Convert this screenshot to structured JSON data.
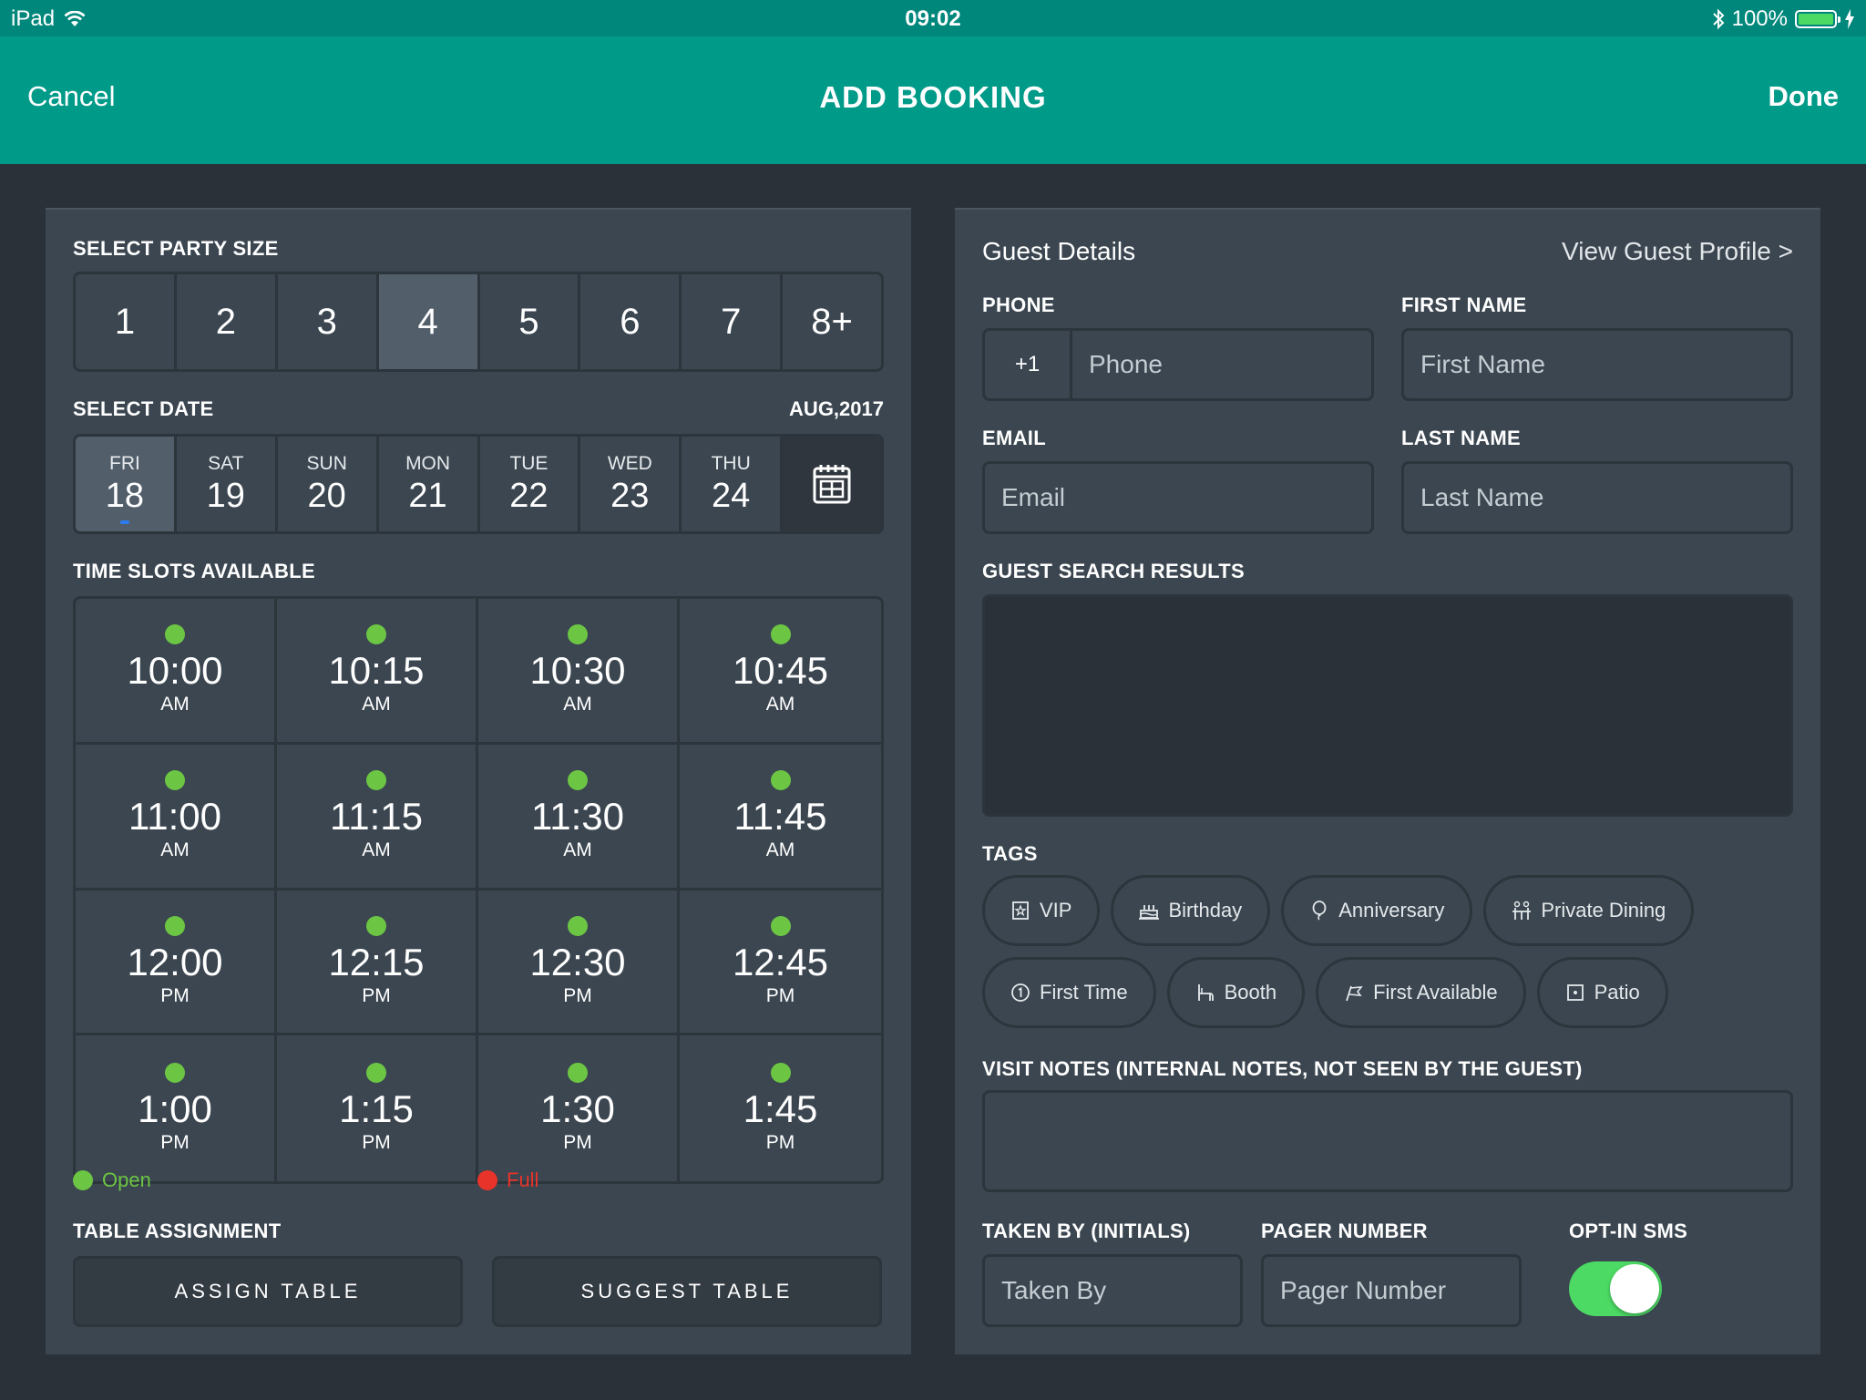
{
  "status_bar": {
    "device": "iPad",
    "time": "09:02",
    "battery": "100%"
  },
  "nav": {
    "cancel": "Cancel",
    "title": "ADD BOOKING",
    "done": "Done"
  },
  "left": {
    "party_label": "SELECT PARTY SIZE",
    "party_sizes": [
      "1",
      "2",
      "3",
      "4",
      "5",
      "6",
      "7",
      "8+"
    ],
    "party_selected": "4",
    "date_label": "SELECT DATE",
    "date_month": "AUG,2017",
    "dates": [
      {
        "dow": "FRI",
        "num": "18"
      },
      {
        "dow": "SAT",
        "num": "19"
      },
      {
        "dow": "SUN",
        "num": "20"
      },
      {
        "dow": "MON",
        "num": "21"
      },
      {
        "dow": "TUE",
        "num": "22"
      },
      {
        "dow": "WED",
        "num": "23"
      },
      {
        "dow": "THU",
        "num": "24"
      }
    ],
    "slots_label": "TIME SLOTS AVAILABLE",
    "slots": [
      {
        "time": "10:00",
        "ampm": "AM"
      },
      {
        "time": "10:15",
        "ampm": "AM"
      },
      {
        "time": "10:30",
        "ampm": "AM"
      },
      {
        "time": "10:45",
        "ampm": "AM"
      },
      {
        "time": "11:00",
        "ampm": "AM"
      },
      {
        "time": "11:15",
        "ampm": "AM"
      },
      {
        "time": "11:30",
        "ampm": "AM"
      },
      {
        "time": "11:45",
        "ampm": "AM"
      },
      {
        "time": "12:00",
        "ampm": "PM"
      },
      {
        "time": "12:15",
        "ampm": "PM"
      },
      {
        "time": "12:30",
        "ampm": "PM"
      },
      {
        "time": "12:45",
        "ampm": "PM"
      },
      {
        "time": "1:00",
        "ampm": "PM"
      },
      {
        "time": "1:15",
        "ampm": "PM"
      },
      {
        "time": "1:30",
        "ampm": "PM"
      },
      {
        "time": "1:45",
        "ampm": "PM"
      }
    ],
    "legend_open": "Open",
    "legend_full": "Full",
    "table_label": "TABLE ASSIGNMENT",
    "assign_table": "ASSIGN TABLE",
    "suggest_table": "SUGGEST TABLE"
  },
  "right": {
    "title": "Guest Details",
    "view_profile": "View Guest Profile >",
    "phone_label": "PHONE",
    "phone_cc": "+1",
    "phone_placeholder": "Phone",
    "first_label": "FIRST NAME",
    "first_placeholder": "First Name",
    "email_label": "EMAIL",
    "email_placeholder": "Email",
    "last_label": "LAST NAME",
    "last_placeholder": "Last Name",
    "results_label": "GUEST SEARCH RESULTS",
    "tags_label": "TAGS",
    "tags_row1": [
      "VIP",
      "Birthday",
      "Anniversary",
      "Private Dining"
    ],
    "tags_row2": [
      "First Time",
      "Booth",
      "First Available",
      "Patio"
    ],
    "notes_label": "VISIT NOTES (INTERNAL NOTES, NOT SEEN BY THE GUEST)",
    "taken_label": "TAKEN BY (INITIALS)",
    "taken_placeholder": "Taken By",
    "pager_label": "PAGER NUMBER",
    "pager_placeholder": "Pager Number",
    "sms_label": "OPT-IN SMS",
    "sms_on": true
  },
  "colors": {
    "teal": "#009a89",
    "open": "#6cc644",
    "full": "#e8332a",
    "bg": "#2a3139",
    "panel": "#3b4650"
  }
}
